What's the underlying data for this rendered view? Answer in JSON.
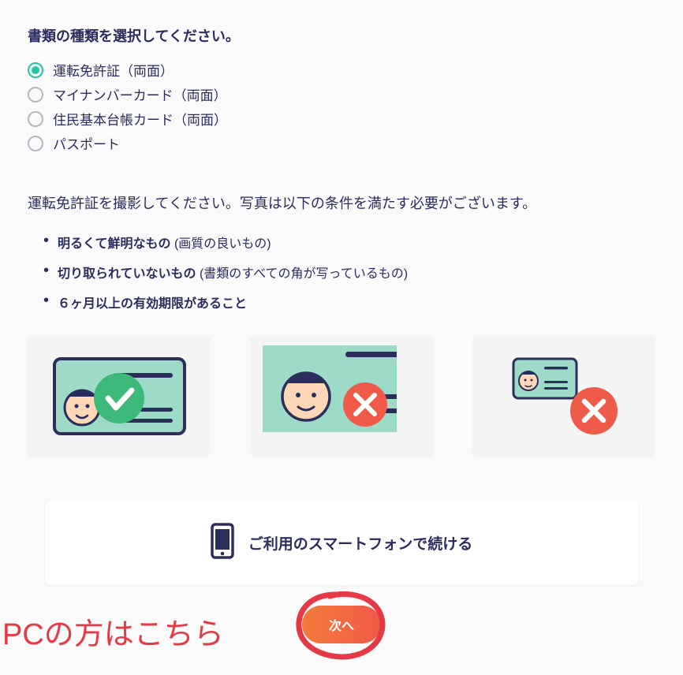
{
  "heading": "書類の種類を選択してください。",
  "documentTypes": {
    "selectedIndex": 0,
    "options": [
      {
        "label": "運転免許証（両面）"
      },
      {
        "label": "マイナンバーカード（両面）"
      },
      {
        "label": "住民基本台帳カード（両面）"
      },
      {
        "label": "パスポート"
      }
    ]
  },
  "instruction": "運転免許証を撮影してください。写真は以下の条件を満たす必要がございます。",
  "requirements": [
    {
      "bold": "明るくて鮮明なもの ",
      "note": "(画質の良いもの)"
    },
    {
      "bold": "切り取られていないもの ",
      "note": "(書類のすべての角が写っているもの)"
    },
    {
      "bold": "６ヶ月以上の有効期限があること",
      "note": ""
    }
  ],
  "examples": {
    "good": {
      "status": "ok"
    },
    "bad_cropped": {
      "status": "error"
    },
    "bad_small": {
      "status": "error"
    }
  },
  "phoneOption": {
    "label": "ご利用のスマートフォンで続ける"
  },
  "annotation": {
    "pcLabel": "PCの方はこちら"
  },
  "nextButton": {
    "label": "次へ"
  }
}
